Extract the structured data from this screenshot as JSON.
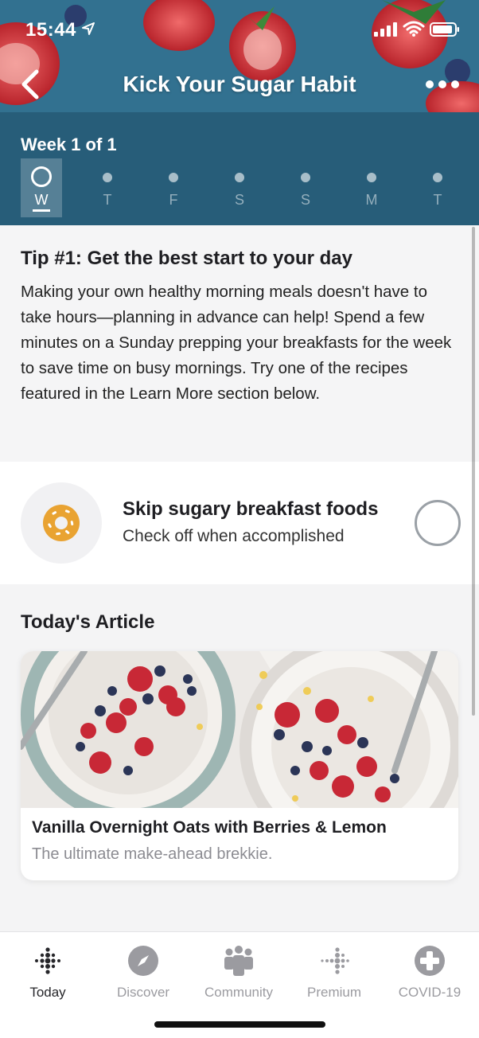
{
  "status": {
    "time": "15:44"
  },
  "header": {
    "title": "Kick Your Sugar Habit"
  },
  "week": {
    "label": "Week 1 of 1",
    "days": [
      "W",
      "T",
      "F",
      "S",
      "S",
      "M",
      "T"
    ],
    "active_index": 0
  },
  "tip": {
    "title": "Tip #1: Get the best start to your day",
    "body": "Making your own healthy morning meals doesn't have to take hours—planning in advance can help! Spend a few minutes on a Sunday prepping your breakfasts for the week to save time on busy mornings. Try one of the recipes featured in the Learn More section below."
  },
  "habit": {
    "icon": "donut-icon",
    "title": "Skip sugary breakfast foods",
    "subtitle": "Check off when accomplished",
    "checked": false
  },
  "article": {
    "section_title": "Today's Article",
    "title": "Vanilla Overnight Oats with Berries & Lemon",
    "subtitle": "The ultimate make-ahead brekkie."
  },
  "tabs": [
    {
      "label": "Today",
      "icon": "today-dots-icon",
      "active": true
    },
    {
      "label": "Discover",
      "icon": "compass-icon",
      "active": false
    },
    {
      "label": "Community",
      "icon": "community-icon",
      "active": false
    },
    {
      "label": "Premium",
      "icon": "premium-dots-icon",
      "active": false
    },
    {
      "label": "COVID-19",
      "icon": "plus-circle-icon",
      "active": false
    }
  ],
  "colors": {
    "header_bg": "#2f6d8c",
    "week_bg": "#275d79",
    "donut": "#e9a332",
    "tab_active": "#26262a",
    "tab_inactive": "#9b9ba0"
  }
}
